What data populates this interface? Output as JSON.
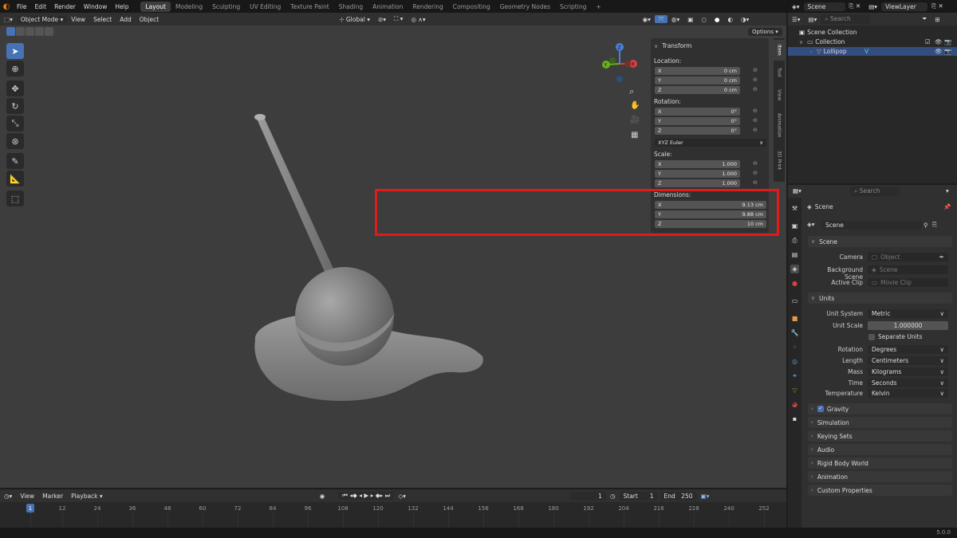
{
  "menubar": {
    "items": [
      "File",
      "Edit",
      "Render",
      "Window",
      "Help"
    ],
    "workspaces": [
      "Layout",
      "Modeling",
      "Sculpting",
      "UV Editing",
      "Texture Paint",
      "Shading",
      "Animation",
      "Rendering",
      "Compositing",
      "Geometry Nodes",
      "Scripting"
    ],
    "active_workspace": "Layout",
    "add_tab": "+"
  },
  "topright": {
    "scene": "Scene",
    "view_layer": "ViewLayer"
  },
  "viewport_header": {
    "mode": "Object Mode",
    "menus": [
      "View",
      "Select",
      "Add",
      "Object"
    ],
    "orientation": "Global",
    "options": "Options"
  },
  "npanel": {
    "transform_title": "Transform",
    "location_label": "Location:",
    "location": [
      {
        "axis": "X",
        "value": "0 cm"
      },
      {
        "axis": "Y",
        "value": "0 cm"
      },
      {
        "axis": "Z",
        "value": "0 cm"
      }
    ],
    "rotation_label": "Rotation:",
    "rotation": [
      {
        "axis": "X",
        "value": "0°"
      },
      {
        "axis": "Y",
        "value": "0°"
      },
      {
        "axis": "Z",
        "value": "0°"
      }
    ],
    "rotation_mode": "XYZ Euler",
    "scale_label": "Scale:",
    "scale": [
      {
        "axis": "X",
        "value": "1.000"
      },
      {
        "axis": "Y",
        "value": "1.000"
      },
      {
        "axis": "Z",
        "value": "1.000"
      }
    ],
    "dimensions_label": "Dimensions:",
    "dimensions": [
      {
        "axis": "X",
        "value": "9.13 cm"
      },
      {
        "axis": "Y",
        "value": "9.88 cm"
      },
      {
        "axis": "Z",
        "value": "10 cm"
      }
    ],
    "tabs": [
      "Item",
      "Tool",
      "View",
      "Animation",
      "3D Print"
    ]
  },
  "timeline": {
    "menus": [
      "View",
      "Marker",
      "Playback"
    ],
    "current_frame": "1",
    "start_label": "Start",
    "start": "1",
    "end_label": "End",
    "end": "250",
    "ticks": [
      "1",
      "12",
      "24",
      "36",
      "48",
      "60",
      "72",
      "84",
      "96",
      "108",
      "120",
      "132",
      "144",
      "156",
      "168",
      "180",
      "192",
      "204",
      "216",
      "228",
      "240",
      "252"
    ]
  },
  "outliner": {
    "search_placeholder": "Search",
    "scene_collection": "Scene Collection",
    "collection": "Collection",
    "object": "Lollipop"
  },
  "properties": {
    "search_placeholder": "Search",
    "breadcrumb": "Scene",
    "datablock": "Scene",
    "scene_section": "Scene",
    "camera_label": "Camera",
    "camera_placeholder": "Object",
    "background_label": "Background Scene",
    "background_placeholder": "Scene",
    "clip_label": "Active Clip",
    "clip_placeholder": "Movie Clip",
    "units_section": "Units",
    "unit_system_label": "Unit System",
    "unit_system": "Metric",
    "unit_scale_label": "Unit Scale",
    "unit_scale": "1.000000",
    "separate_units": "Separate Units",
    "rotation_label": "Rotation",
    "rotation": "Degrees",
    "length_label": "Length",
    "length": "Centimeters",
    "mass_label": "Mass",
    "mass": "Kilograms",
    "time_label": "Time",
    "time": "Seconds",
    "temperature_label": "Temperature",
    "temperature": "Kelvin",
    "sections": [
      "Gravity",
      "Simulation",
      "Keying Sets",
      "Audio",
      "Rigid Body World",
      "Animation",
      "Custom Properties"
    ]
  },
  "statusbar": {
    "version": "5.0.0"
  },
  "colors": {
    "accent": "#4772b3",
    "highlight_box": "#e11a1a",
    "brand": "#e87d0d"
  }
}
